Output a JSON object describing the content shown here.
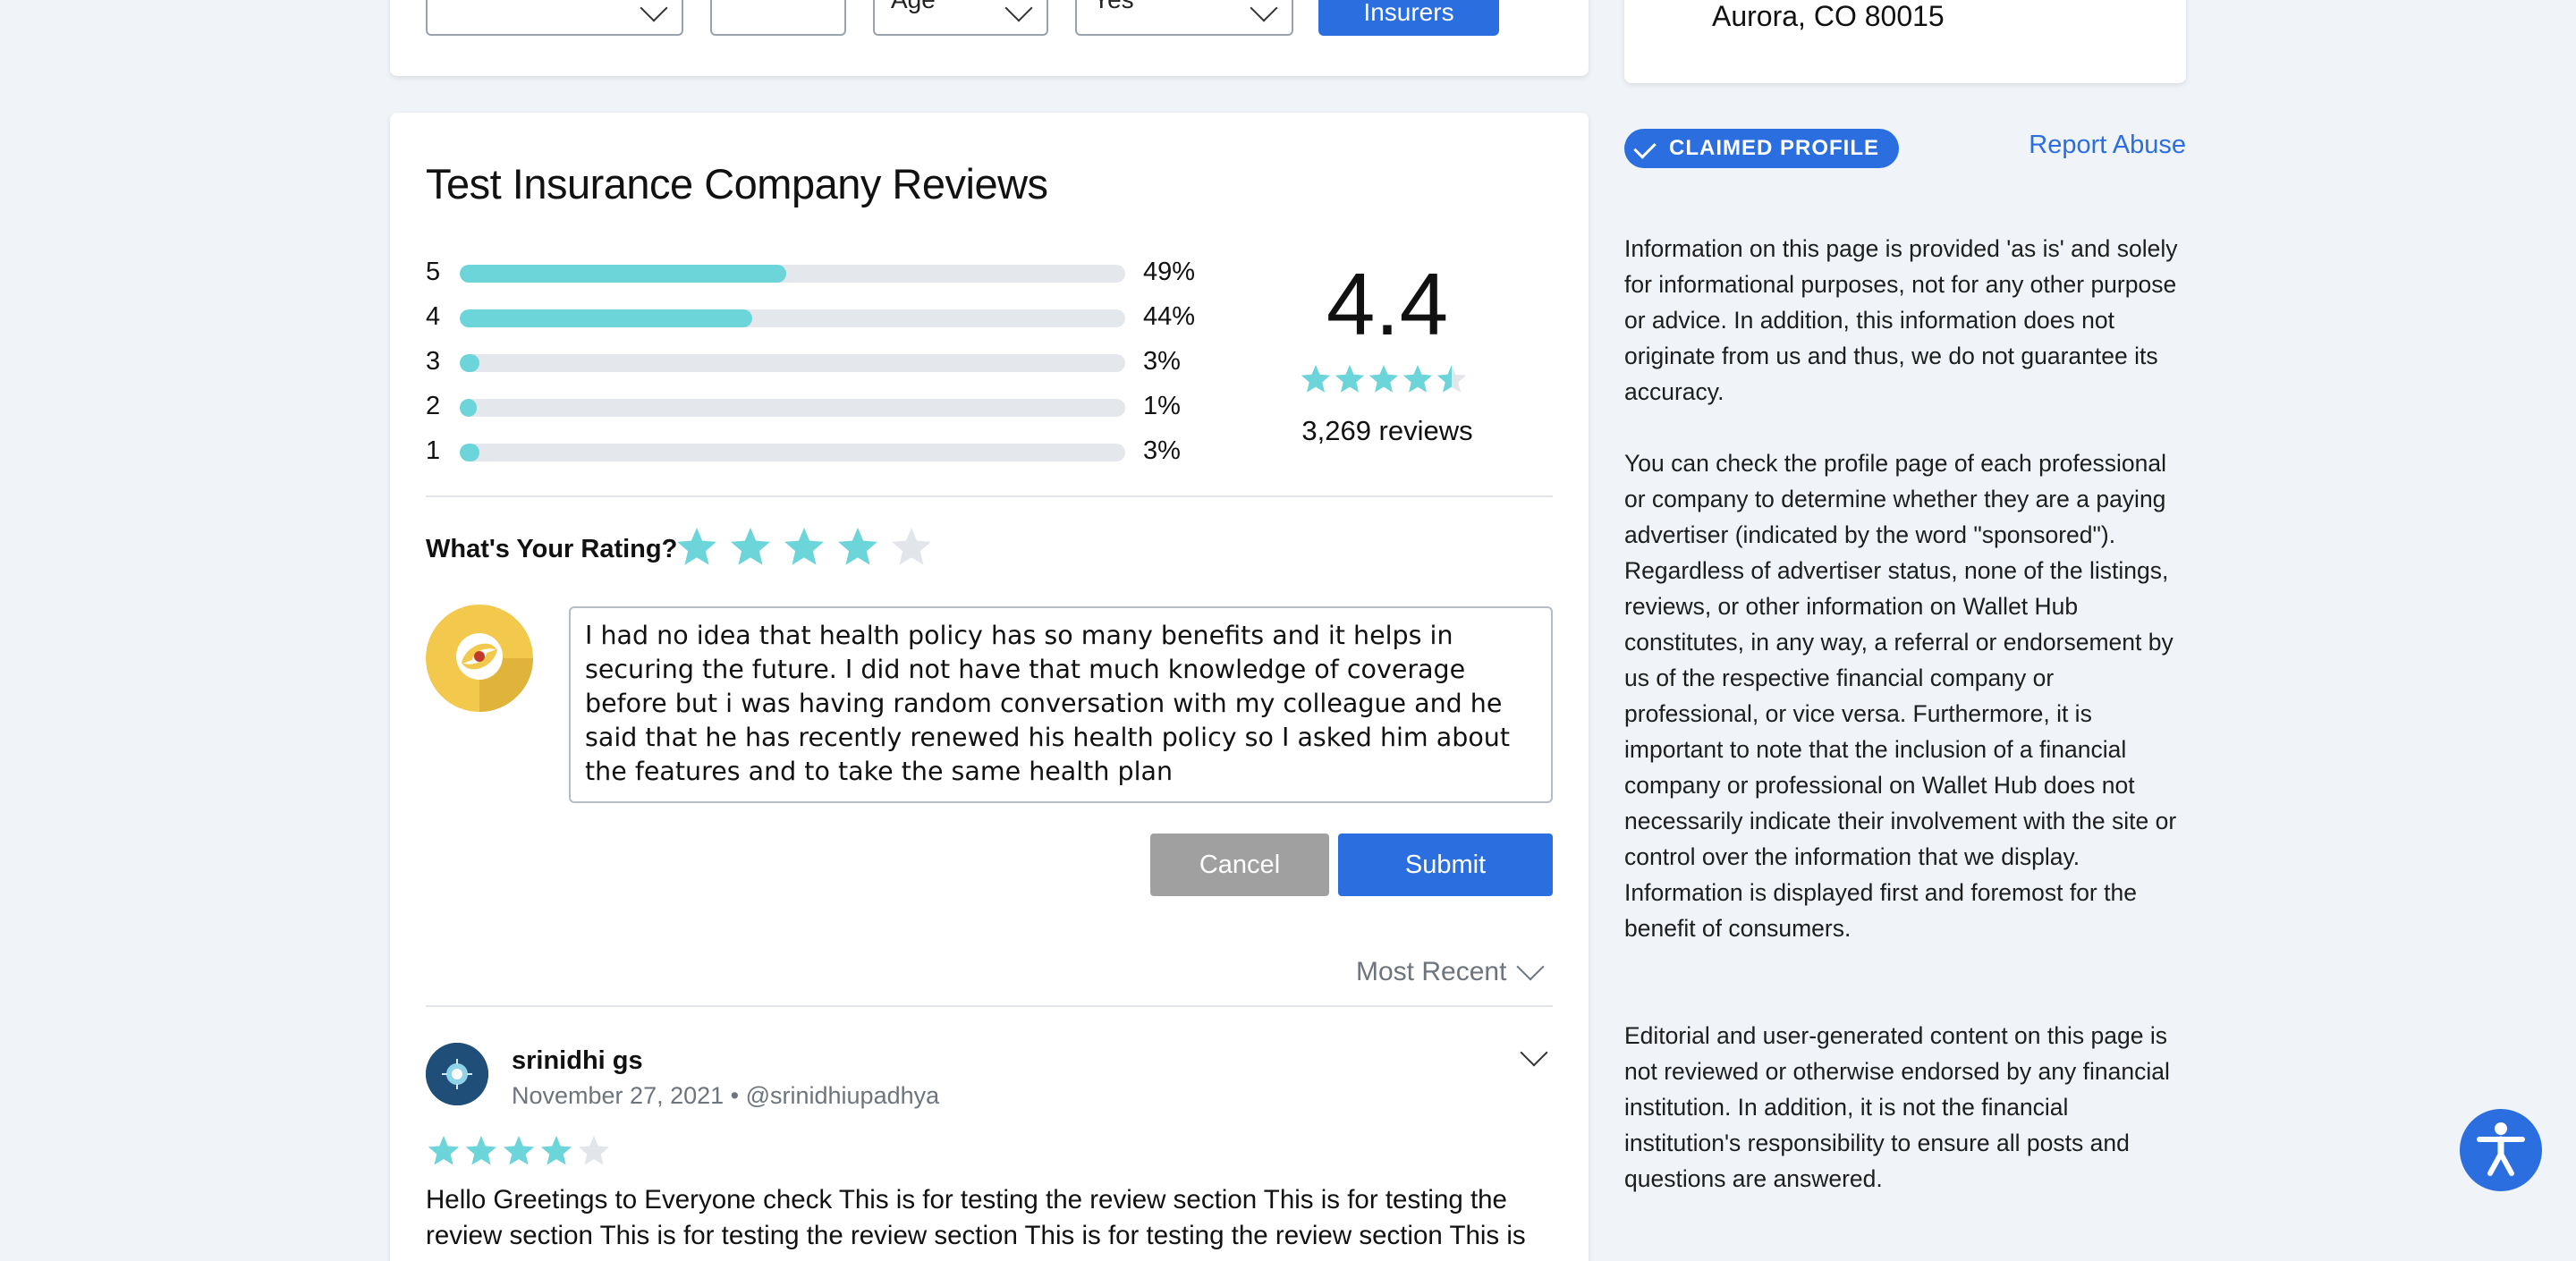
{
  "filters": {
    "select1": "",
    "input2": "",
    "age_label": "Age",
    "yes_label": "Yes",
    "insurers_button": "Insurers"
  },
  "address": {
    "line": "Aurora, CO 80015"
  },
  "reviews_section": {
    "title": "Test Insurance Company Reviews",
    "distribution": [
      {
        "stars": "5",
        "percent_label": "49%",
        "fraction": 0.49
      },
      {
        "stars": "4",
        "percent_label": "44%",
        "fraction": 0.44
      },
      {
        "stars": "3",
        "percent_label": "3%",
        "fraction": 0.03
      },
      {
        "stars": "2",
        "percent_label": "1%",
        "fraction": 0.01
      },
      {
        "stars": "1",
        "percent_label": "3%",
        "fraction": 0.03
      }
    ],
    "average_rating": "4.4",
    "average_stars": 4.5,
    "review_count": "3,269 reviews",
    "your_rating_label": "What's Your Rating?",
    "your_rating_value": 4,
    "review_text": "I had no idea that health policy has so many benefits and it helps in securing the future. I did not have that much knowledge of coverage before but i was having random conversation with my colleague and he said that he has recently renewed his health policy so I asked him about the features and to take the same health plan",
    "cancel_button": "Cancel",
    "submit_button": "Submit",
    "sort_label": "Most Recent"
  },
  "review": {
    "reviewer_name": "srinidhi gs",
    "meta": "November 27, 2021 • @srinidhiupadhya",
    "rating": 4,
    "body": "Hello Greetings to Everyone check This is for testing the review section This is for testing the review section This is for testing the review section This is for testing the review section This is"
  },
  "sidebar": {
    "claimed_badge": "CLAIMED PROFILE",
    "report_abuse": "Report Abuse",
    "paragraphs": [
      "Information on this page is provided 'as is' and solely for informational purposes, not for any other purpose or advice. In addition, this information does not originate from us and thus, we do not guarantee its accuracy.",
      "You can check the profile page of each professional or company to determine whether they are a paying advertiser (indicated by the word \"sponsored\"). Regardless of advertiser status, none of the listings, reviews, or other information on Wallet Hub constitutes, in any way, a referral or endorsement by us of the respective financial company or professional, or vice versa. Furthermore, it is important to note that the inclusion of a financial company or professional on Wallet Hub does not necessarily indicate their involvement with the site or control over the information that we display. Information is displayed first and foremost for the benefit of consumers.",
      "Editorial and user-generated content on this page is not reviewed or otherwise endorsed by any financial institution. In addition, it is not the financial institution's responsibility to ensure all posts and questions are answered."
    ]
  },
  "colors": {
    "accent": "#2b6ee0",
    "bar_fill": "#6cd5d9",
    "star_empty": "#e2e5ea"
  }
}
